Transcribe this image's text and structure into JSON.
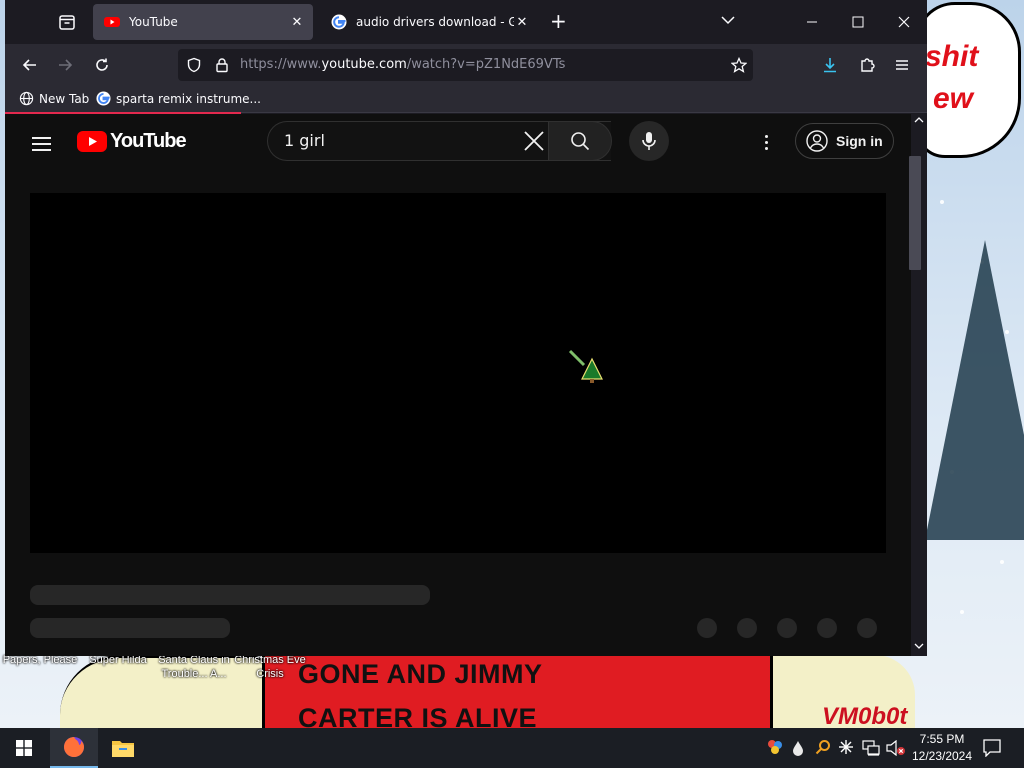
{
  "browser": {
    "tabs": [
      {
        "title": "YouTube",
        "active": true
      },
      {
        "title": "audio drivers download - Goog",
        "active": false
      }
    ],
    "url": {
      "prefix": "https://www.",
      "domain": "youtube.com",
      "path": "/watch?v=pZ1NdE69VTs"
    },
    "bookmarks": [
      "New Tab",
      "sparta remix instrume..."
    ],
    "accent_color": "#e3294e"
  },
  "youtube": {
    "logo_text": "YouTube",
    "search_value": "1 girl",
    "sign_in_label": "Sign in",
    "brand_color": "#ff0000"
  },
  "desktop": {
    "icons": [
      {
        "label": "Papers, Please"
      },
      {
        "label": "Super Hilda"
      },
      {
        "label": "Santa Claus in Trouble... A..."
      },
      {
        "label": "Christmas Eve Crisis"
      }
    ],
    "wallpaper_speech": [
      "shit",
      "ew"
    ],
    "wallpaper_sign": [
      "GONE AND JIMMY",
      "CARTER IS ALIVE"
    ],
    "wallpaper_signature": "VM0b0t"
  },
  "taskbar": {
    "time": "7:55 PM",
    "date": "12/23/2024",
    "pinned": [
      "firefox-icon",
      "file-explorer-icon"
    ]
  }
}
